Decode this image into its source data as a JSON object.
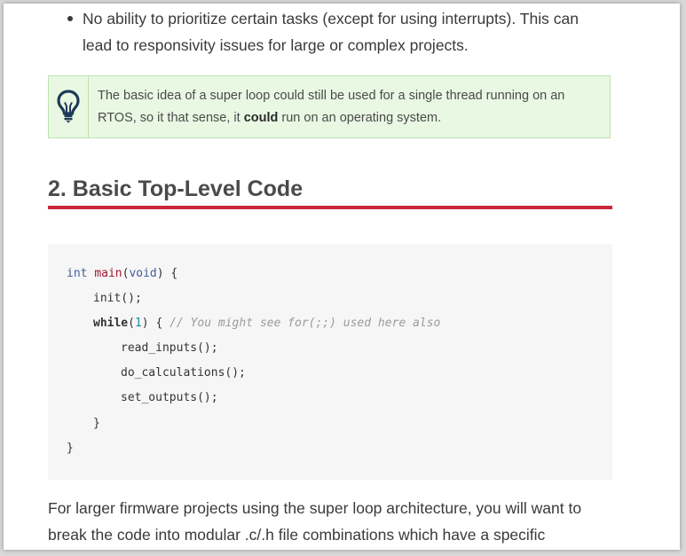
{
  "bullet": {
    "line1": "No ability to prioritize certain tasks (except for using interrupts). This can",
    "line2": "lead to responsivity issues for large or complex projects."
  },
  "tip": {
    "icon": "lightbulb-icon",
    "line1": "The basic idea of a super loop could still be used for a single thread running on an",
    "line2_before": "RTOS, so it that sense, it ",
    "line2_bold": "could",
    "line2_after": " run on an operating system."
  },
  "section": {
    "title": "2. Basic Top-Level Code"
  },
  "code": {
    "l1_type": "int",
    "l1_func": "main",
    "l1_paren_open": "(",
    "l1_param": "void",
    "l1_rest": ") {",
    "l2": "init();",
    "l3_kw": "while",
    "l3_paren_open": "(",
    "l3_num": "1",
    "l3_rest": ") { ",
    "l3_comment": "// You might see for(;;) used here also",
    "l4": "read_inputs();",
    "l5": "do_calculations();",
    "l6": "set_outputs();",
    "l7": "}",
    "l8": "}"
  },
  "paragraph": {
    "line1": "For larger firmware projects using the super loop architecture, you will want to",
    "line2": "break the code into modular .c/.h file combinations which have a specific"
  },
  "colors": {
    "accent_rule": "#c8283c",
    "tip_background": "#e9f8e3",
    "tip_icon": "#1f3a57",
    "code_background": "#f6f6f6"
  }
}
